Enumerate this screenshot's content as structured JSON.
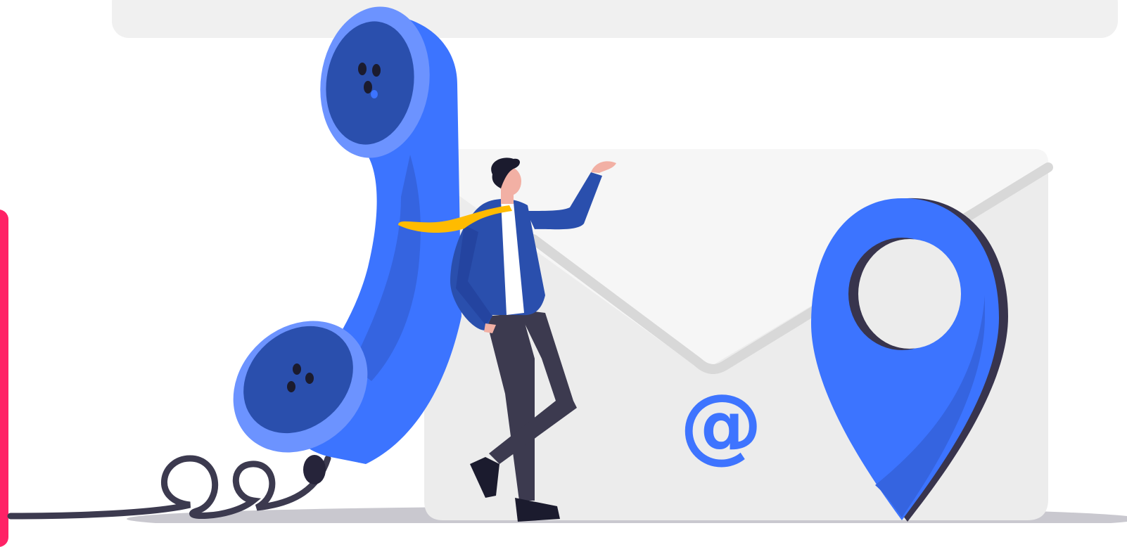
{
  "illustration": {
    "envelope_symbol": "@",
    "colors": {
      "accent_blue": "#3e74ff",
      "dark_blue": "#2a4fad",
      "pin_blue": "#3c74ff",
      "envelope_light": "#f5f5f5",
      "envelope_mid": "#ebebeb",
      "cord": "#3c3a4f",
      "tie": "#ffbb00",
      "side_accent": "#ff2266"
    },
    "icons": [
      "phone-handset-icon",
      "envelope-icon",
      "map-pin-icon",
      "person-figure"
    ]
  }
}
